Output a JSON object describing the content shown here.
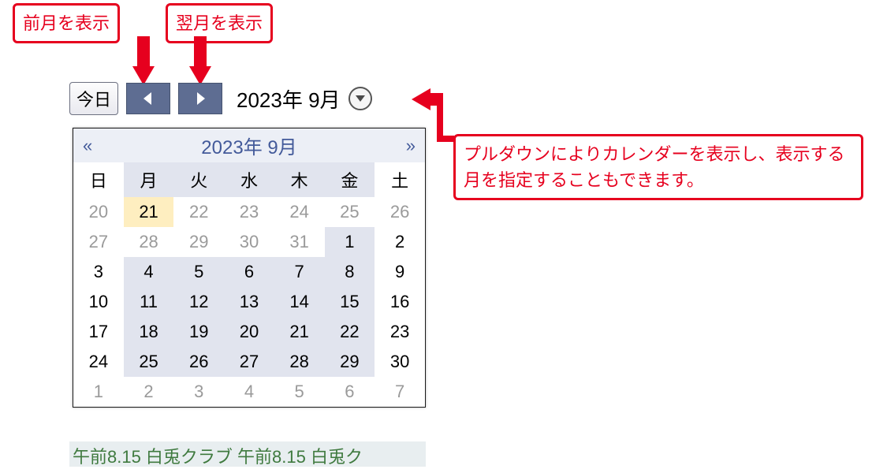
{
  "annotations": {
    "prev_label": "前月を表示",
    "next_label": "翌月を表示",
    "dropdown_note": "プルダウンによりカレンダーを表示し、表示する月を指定することもできます。"
  },
  "toolbar": {
    "today_label": "今日",
    "year_month": "2023年 9月"
  },
  "calendar": {
    "header_prev": "«",
    "header_next": "»",
    "header_title": "2023年 9月",
    "weekdays": [
      "日",
      "月",
      "火",
      "水",
      "木",
      "金",
      "土"
    ],
    "rows": [
      [
        {
          "d": "20",
          "cls": "other"
        },
        {
          "d": "21",
          "cls": "highlight"
        },
        {
          "d": "22",
          "cls": "other"
        },
        {
          "d": "23",
          "cls": "other"
        },
        {
          "d": "24",
          "cls": "other"
        },
        {
          "d": "25",
          "cls": "other"
        },
        {
          "d": "26",
          "cls": "other"
        }
      ],
      [
        {
          "d": "27",
          "cls": "other"
        },
        {
          "d": "28",
          "cls": "other"
        },
        {
          "d": "29",
          "cls": "other"
        },
        {
          "d": "30",
          "cls": "other"
        },
        {
          "d": "31",
          "cls": "other"
        },
        {
          "d": "1",
          "cls": "in"
        },
        {
          "d": "2",
          "cls": "in-weekend"
        }
      ],
      [
        {
          "d": "3",
          "cls": "in-weekend"
        },
        {
          "d": "4",
          "cls": "in"
        },
        {
          "d": "5",
          "cls": "in"
        },
        {
          "d": "6",
          "cls": "in"
        },
        {
          "d": "7",
          "cls": "in"
        },
        {
          "d": "8",
          "cls": "in"
        },
        {
          "d": "9",
          "cls": "in-weekend"
        }
      ],
      [
        {
          "d": "10",
          "cls": "in-weekend"
        },
        {
          "d": "11",
          "cls": "in"
        },
        {
          "d": "12",
          "cls": "in"
        },
        {
          "d": "13",
          "cls": "in"
        },
        {
          "d": "14",
          "cls": "in"
        },
        {
          "d": "15",
          "cls": "in"
        },
        {
          "d": "16",
          "cls": "in-weekend"
        }
      ],
      [
        {
          "d": "17",
          "cls": "in-weekend"
        },
        {
          "d": "18",
          "cls": "in"
        },
        {
          "d": "19",
          "cls": "in"
        },
        {
          "d": "20",
          "cls": "in"
        },
        {
          "d": "21",
          "cls": "in"
        },
        {
          "d": "22",
          "cls": "in"
        },
        {
          "d": "23",
          "cls": "in-weekend"
        }
      ],
      [
        {
          "d": "24",
          "cls": "in-weekend"
        },
        {
          "d": "25",
          "cls": "in"
        },
        {
          "d": "26",
          "cls": "in"
        },
        {
          "d": "27",
          "cls": "in"
        },
        {
          "d": "28",
          "cls": "in"
        },
        {
          "d": "29",
          "cls": "in"
        },
        {
          "d": "30",
          "cls": "in-weekend"
        }
      ],
      [
        {
          "d": "1",
          "cls": "other"
        },
        {
          "d": "2",
          "cls": "other"
        },
        {
          "d": "3",
          "cls": "other"
        },
        {
          "d": "4",
          "cls": "other"
        },
        {
          "d": "5",
          "cls": "other"
        },
        {
          "d": "6",
          "cls": "other"
        },
        {
          "d": "7",
          "cls": "other"
        }
      ]
    ]
  },
  "background_event_text": "午前8.15 白兎クラブ  午前8.15 白兎ク"
}
